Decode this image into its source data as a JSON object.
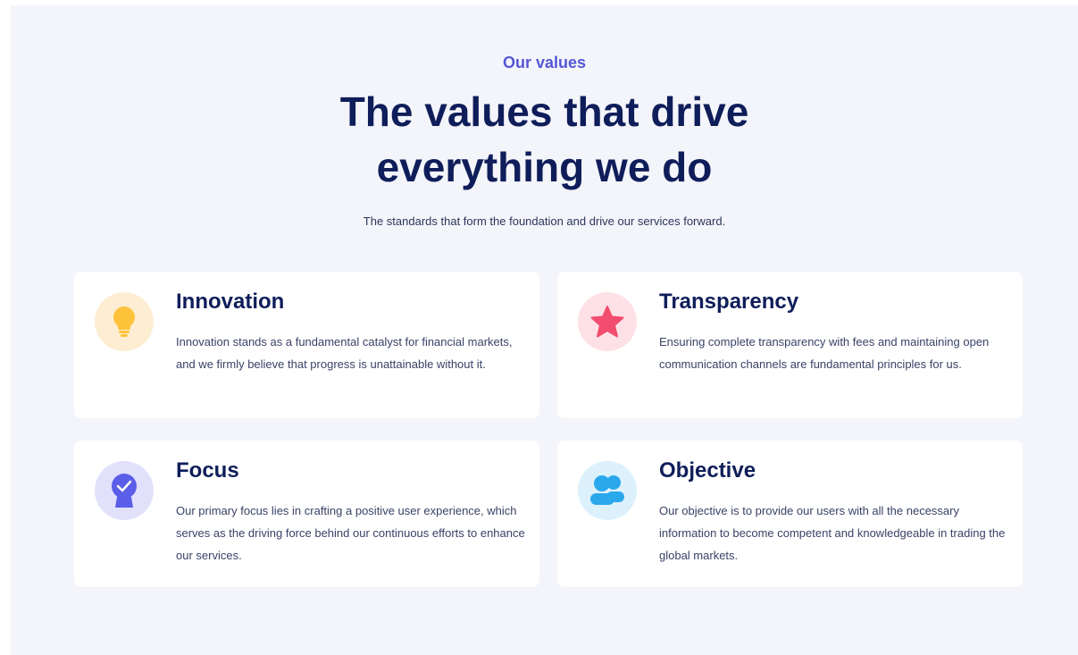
{
  "section": {
    "eyebrow": "Our values",
    "headline_line1": "The values that drive",
    "headline_line2": "everything we do",
    "subtitle": "The standards that form the foundation and drive our services forward."
  },
  "cards": [
    {
      "title": "Innovation",
      "description": "Innovation stands as a fundamental catalyst for financial markets, and we firmly believe that progress is unattainable without it.",
      "icon": "lightbulb-icon",
      "icon_color": "#ffc23b",
      "icon_bg": "#fdeed3"
    },
    {
      "title": "Transparency",
      "description": "Ensuring complete transparency with fees and maintaining open communication channels are fundamental principles for us.",
      "icon": "star-icon",
      "icon_color": "#f24c6e",
      "icon_bg": "#fde1e6"
    },
    {
      "title": "Focus",
      "description": "Our primary focus lies in crafting a positive user experience, which serves as the driving force behind our continuous efforts to enhance our services.",
      "icon": "badge-check-icon",
      "icon_color": "#5b5ee8",
      "icon_bg": "#e1e1fb"
    },
    {
      "title": "Objective",
      "description": "Our objective is to provide our users with all the necessary information to become competent and knowledgeable in trading the global markets.",
      "icon": "users-icon",
      "icon_color": "#2aa8ec",
      "icon_bg": "#dcf1fc"
    }
  ],
  "colors": {
    "accent": "#5457d6",
    "heading": "#0f1e5a",
    "section_bg": "#f4f5fa",
    "card_bg": "#ffffff"
  }
}
